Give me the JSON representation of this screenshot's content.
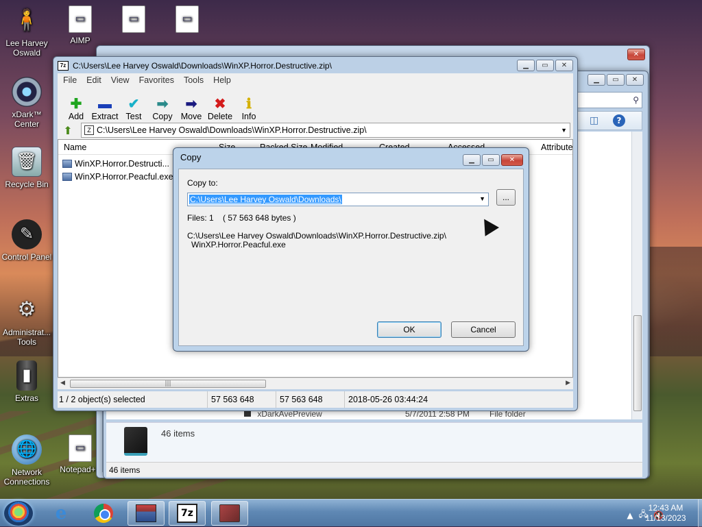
{
  "desktop": {
    "icons": [
      {
        "label": "Lee Harvey Oswald",
        "icon": "user-folder-icon"
      },
      {
        "label": "AIMP",
        "icon": "aimp-icon"
      },
      {
        "label": "",
        "icon": "settings-doc-icon"
      },
      {
        "label": "",
        "icon": "firefox-doc-icon"
      },
      {
        "label": "xDark™ Center",
        "icon": "xdark-center-icon"
      },
      {
        "label": "Recycle Bin",
        "icon": "recycle-bin-icon"
      },
      {
        "label": "Control Panel",
        "icon": "control-panel-icon"
      },
      {
        "label": "Administrat... Tools",
        "icon": "admin-tools-icon"
      },
      {
        "label": "Extras",
        "icon": "extras-icon"
      },
      {
        "label": "Network Connections",
        "icon": "network-icon"
      },
      {
        "label": "Notepad++",
        "icon": "notepad-icon"
      }
    ]
  },
  "explorer": {
    "row_name": "xDarkAvePreview",
    "row_date": "5/7/2011 2:58 PM",
    "row_type": "File folder",
    "items_detail": "46 items",
    "status": "46 items"
  },
  "zip": {
    "title": "C:\\Users\\Lee Harvey Oswald\\Downloads\\WinXP.Horror.Destructive.zip\\",
    "menu": [
      "File",
      "Edit",
      "View",
      "Favorites",
      "Tools",
      "Help"
    ],
    "toolbar": [
      {
        "label": "Add",
        "icon": "plus-icon",
        "color": "#1fa51f",
        "glyph": "✚"
      },
      {
        "label": "Extract",
        "icon": "minus-icon",
        "color": "#1a3fb8",
        "glyph": "▬"
      },
      {
        "label": "Test",
        "icon": "check-icon",
        "color": "#19b1c9",
        "glyph": "✔"
      },
      {
        "label": "Copy",
        "icon": "copy-arrow-icon",
        "color": "#2a8a8a",
        "glyph": "➡"
      },
      {
        "label": "Move",
        "icon": "move-arrow-icon",
        "color": "#1a1a80",
        "glyph": "➡"
      },
      {
        "label": "Delete",
        "icon": "delete-x-icon",
        "color": "#d41c1c",
        "glyph": "✖"
      },
      {
        "label": "Info",
        "icon": "info-icon",
        "color": "#d4b000",
        "glyph": "ℹ"
      }
    ],
    "address": "C:\\Users\\Lee Harvey Oswald\\Downloads\\WinXP.Horror.Destructive.zip\\",
    "columns": [
      "Name",
      "Size",
      "Packed Size",
      "Modified",
      "Created",
      "Accessed",
      "Attributes"
    ],
    "files": [
      {
        "name": "WinXP.Horror.Destructi..."
      },
      {
        "name": "WinXP.Horror.Peacful.exe"
      }
    ],
    "status": {
      "selected": "1 / 2 object(s) selected",
      "size": "57 563 648",
      "packed": "57 563 648",
      "modified": "2018-05-26 03:44:24"
    }
  },
  "copy_dialog": {
    "title": "Copy",
    "copy_to_label": "Copy to:",
    "destination": "C:\\Users\\Lee Harvey Oswald\\Downloads\\",
    "browse": "...",
    "files_info": "Files: 1    ( 57 563 648 bytes )",
    "source_line1": "C:\\Users\\Lee Harvey Oswald\\Downloads\\WinXP.Horror.Destructive.zip\\",
    "source_line2": "WinXP.Horror.Peacful.exe",
    "ok": "OK",
    "cancel": "Cancel"
  },
  "taskbar": {
    "time": "12:43 AM",
    "date": "11/13/2023",
    "apps": [
      "internet-explorer-icon",
      "chrome-icon",
      "archive-app-icon",
      "7zip-icon",
      "winrar-icon"
    ]
  }
}
